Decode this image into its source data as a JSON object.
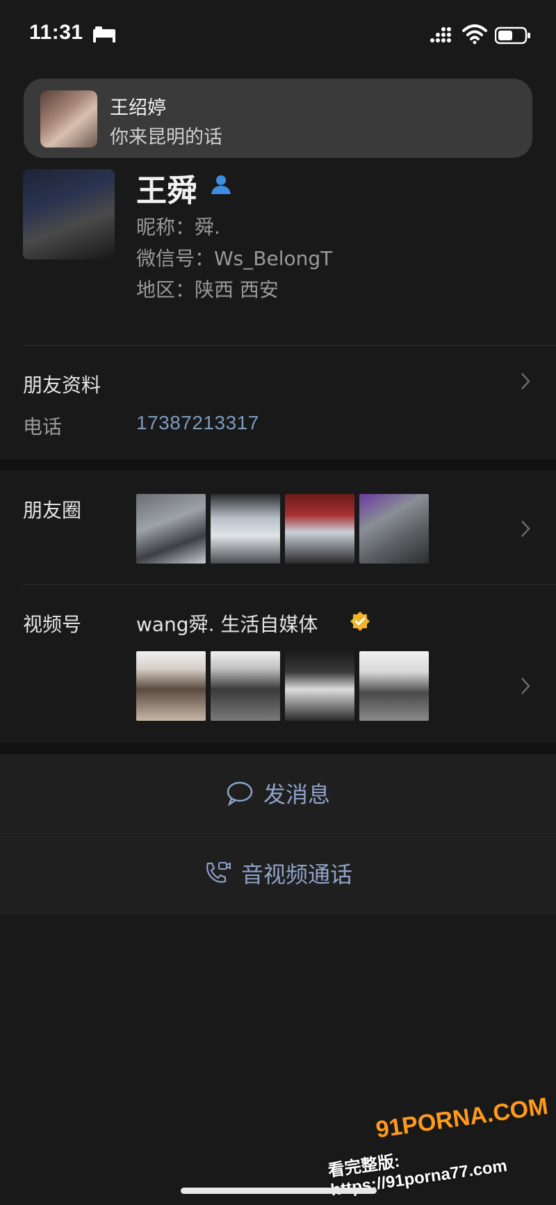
{
  "status_bar": {
    "time": "11:31"
  },
  "notification": {
    "sender": "王绍婷",
    "message": "你来昆明的话"
  },
  "profile": {
    "name": "王舜",
    "nickname": "昵称：舜.",
    "wechat_id": "微信号：Ws_BelongT",
    "region": "地区：陕西  西安"
  },
  "friend_info": {
    "label": "朋友资料",
    "phone_label": "电话",
    "phone_value": "17387213317"
  },
  "moments": {
    "label": "朋友圈",
    "photos": [
      "car-photo-1",
      "car-photo-2",
      "car-photo-3",
      "car-photo-4"
    ]
  },
  "channels": {
    "label": "视频号",
    "channel_name": "wang舜.  生活自媒体",
    "videos": [
      "video-thumb-1",
      "video-thumb-2",
      "video-thumb-3",
      "video-thumb-4"
    ]
  },
  "actions": {
    "send_message": "发消息",
    "av_call": "音视频通话"
  },
  "watermark": {
    "brand": "91PORNA.COM",
    "url_line": "看完整版: https://91porna77.com"
  },
  "colors": {
    "background": "#191919",
    "link_blue": "#7c9bbd",
    "action_blue": "#8fa3c8",
    "verified_gold": "#f0b429"
  }
}
